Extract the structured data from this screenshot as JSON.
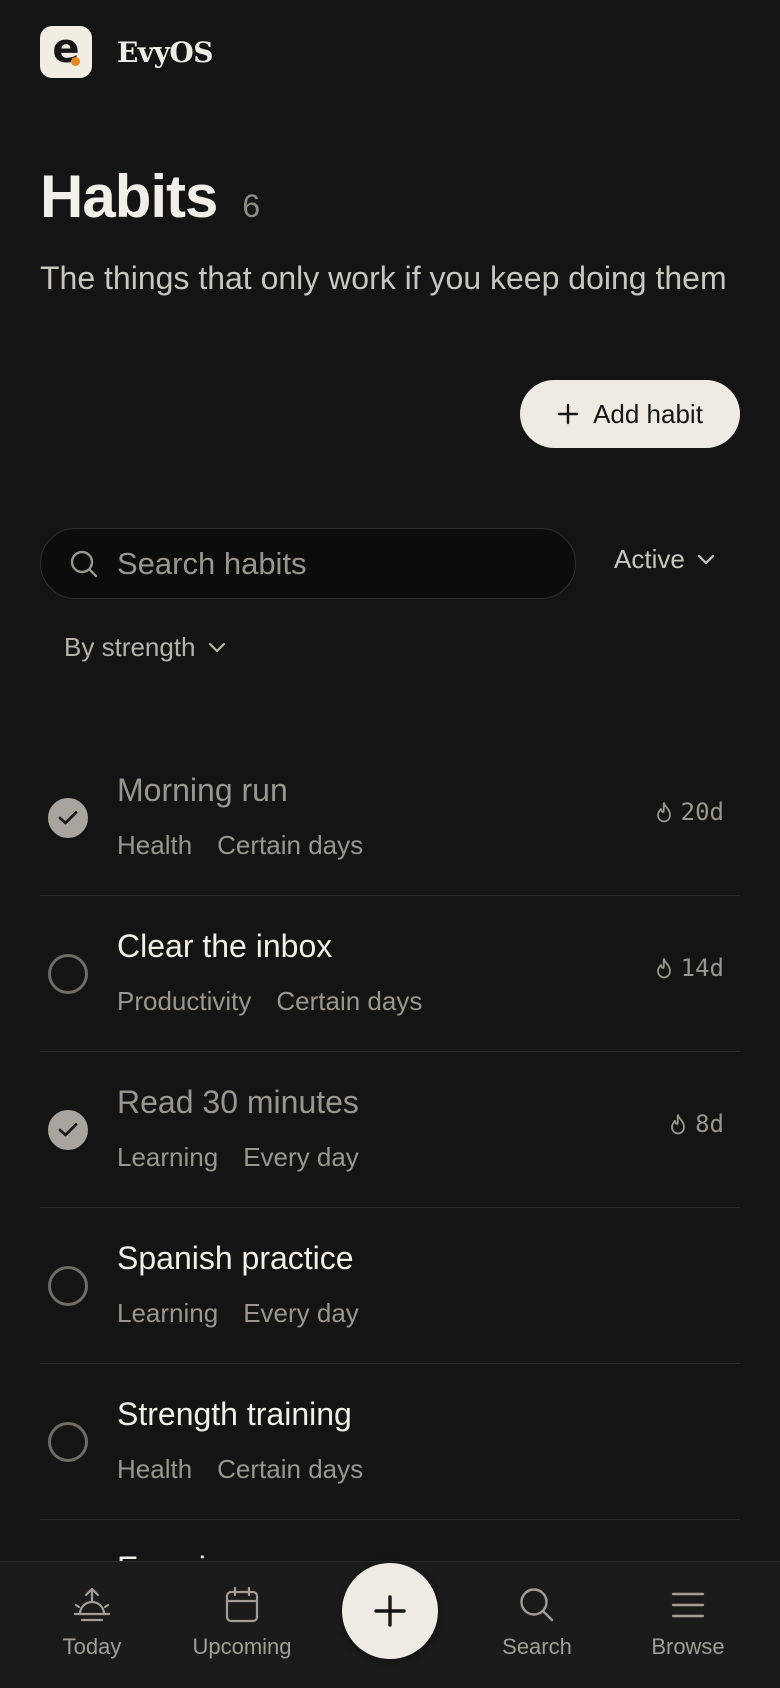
{
  "app": {
    "logo_letter": "e",
    "name": "EvyOS"
  },
  "page": {
    "title": "Habits",
    "count": "6",
    "subtitle": "The things that only work if you keep doing them"
  },
  "actions": {
    "add_habit_label": "Add habit"
  },
  "search": {
    "placeholder": "Search habits",
    "value": ""
  },
  "filters": {
    "status": "Active",
    "sort": "By strength"
  },
  "habits": [
    {
      "name": "Morning run",
      "category": "Health",
      "schedule": "Certain days",
      "streak": "20d",
      "completed": true
    },
    {
      "name": "Clear the inbox",
      "category": "Productivity",
      "schedule": "Certain days",
      "streak": "14d",
      "completed": false
    },
    {
      "name": "Read 30 minutes",
      "category": "Learning",
      "schedule": "Every day",
      "streak": "8d",
      "completed": true
    },
    {
      "name": "Spanish practice",
      "category": "Learning",
      "schedule": "Every day",
      "streak": "",
      "completed": false
    },
    {
      "name": "Strength training",
      "category": "Health",
      "schedule": "Certain days",
      "streak": "",
      "completed": false
    },
    {
      "name": "Examine",
      "category": "",
      "schedule": "",
      "streak": "",
      "completed": false
    }
  ],
  "nav": {
    "today": "Today",
    "upcoming": "Upcoming",
    "search": "Search",
    "browse": "Browse"
  },
  "colors": {
    "background": "#141414",
    "surface": "#1b1b1b",
    "accent_light": "#efebe3",
    "logo_dot": "#e88a1a",
    "muted_text": "#9a968f"
  }
}
